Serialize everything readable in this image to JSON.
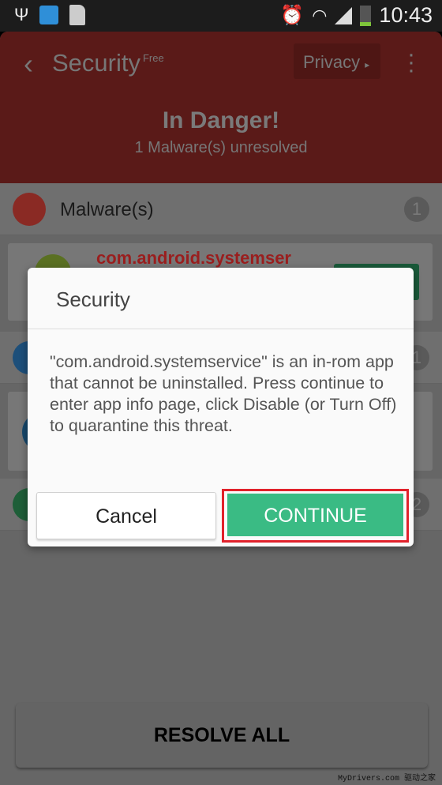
{
  "status_bar": {
    "time": "10:43",
    "icons_left": [
      "usb-icon",
      "app-notification-icon",
      "sim-card-alert-icon"
    ],
    "icons_right": [
      "alarm-icon",
      "wifi-icon",
      "signal-icon",
      "battery-charging-icon"
    ]
  },
  "header": {
    "title": "Security",
    "edition": "Free",
    "privacy_button": "Privacy",
    "status_title": "In Danger!",
    "status_subtitle": "1 Malware(s) unresolved",
    "color": "#b73532"
  },
  "sections": [
    {
      "label": "Malware(s)",
      "count": "1",
      "icon": "skull-icon",
      "color": "#c0352f"
    },
    {
      "label": "",
      "count": "1",
      "icon": "globe-icon",
      "color": "#2b7bbf"
    },
    {
      "label": "",
      "count": "2",
      "icon": "privacy-icon",
      "color": "#2e9b5a"
    }
  ],
  "malware_item": {
    "name": "com.android.systemser"
  },
  "resolve_all": "RESOLVE ALL",
  "dialog": {
    "title": "Security",
    "message": "\"com.android.systemservice\" is an in-rom app that cannot be uninstalled. Press continue to enter app info page, click Disable (or Turn Off) to quarantine this threat.",
    "cancel": "Cancel",
    "continue": "CONTINUE",
    "continue_color": "#3abb84",
    "highlight_color": "#e1222b"
  },
  "watermark": "MyDrivers.com 驱动之家"
}
